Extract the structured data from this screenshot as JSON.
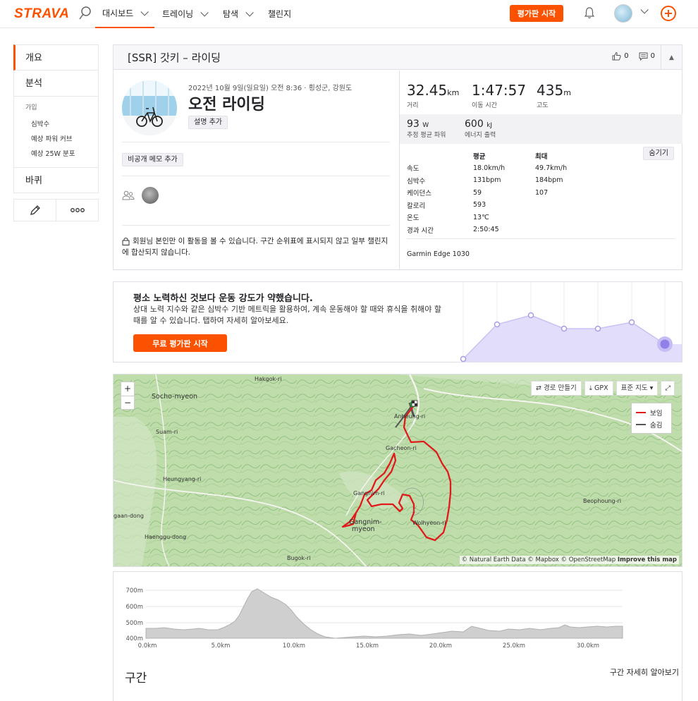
{
  "nav": {
    "logo": "STRAVA",
    "items": [
      {
        "label": "대시보드"
      },
      {
        "label": "트레이닝"
      },
      {
        "label": "탐색"
      },
      {
        "label": "챌린지"
      }
    ],
    "cta": "평가판 시작",
    "brand_color": "#fc5200"
  },
  "sidebar": {
    "overview": "개요",
    "analysis": "분석",
    "group_title": "가입",
    "sub_items": [
      "심박수",
      "예상 파워 커브",
      "예상 25W 분포"
    ],
    "bike": "바퀴"
  },
  "activity": {
    "header": "[SSR] 갓키 – 라이딩",
    "kudos": "0",
    "comments": "0",
    "meta": "2022년 10월 9일(일요일) 오전 8:36 · 횡성군, 강원도",
    "title": "오전 라이딩",
    "add_description": "설명 추가",
    "private_note": "비공개 메모 추가",
    "privacy": "회원님 본인만 이 활동을 볼 수 있습니다. 구간 순위표에 표시되지 않고 일부 챌린지에 합산되지 않습니다.",
    "stats": {
      "distance_value": "32.45",
      "distance_unit": "km",
      "distance_label": "거리",
      "time_value": "1:47:57",
      "time_label": "이동 시간",
      "elev_value": "435",
      "elev_unit": "m",
      "elev_label": "고도",
      "power_value": "93",
      "power_unit": "W",
      "power_label": "추정 평균 파워",
      "energy_value": "600",
      "energy_unit": "kJ",
      "energy_label": "에너지 출력"
    },
    "table_head": {
      "avg": "평균",
      "max": "최대"
    },
    "hide": "숨기기",
    "rows": [
      {
        "label": "속도",
        "avg": "18.0km/h",
        "max": "49.7km/h"
      },
      {
        "label": "심박수",
        "avg": "131bpm",
        "max": "184bpm"
      },
      {
        "label": "케이던스",
        "avg": "59",
        "max": "107"
      },
      {
        "label": "칼로리",
        "avg": "593",
        "max": ""
      },
      {
        "label": "온도",
        "avg": "13℃",
        "max": ""
      },
      {
        "label": "경과 시간",
        "avg": "2:50:45",
        "max": ""
      }
    ],
    "device": "Garmin Edge 1030"
  },
  "promo": {
    "title": "평소 노력하신 것보다 운동 강도가 약했습니다.",
    "body": "상대 노력 지수와 같은 심박수 기반 메트릭을 활용하여, 계속 운동해야 할 때와 휴식을 취해야 할 때를 알 수 있습니다. 탭하여 자세히 알아보세요.",
    "button": "무료 평가판 시작",
    "chart_color": "#d9d4f7"
  },
  "map": {
    "tools": {
      "route": "경로 만들기",
      "gpx": "GPX",
      "style": "표준 지도"
    },
    "legend": {
      "shown": "보임",
      "hidden": "숨김"
    },
    "route_color": "#e01b1b",
    "hidden_color": "#555555",
    "attribution_prefix": "© Natural Earth Data © Mapbox © OpenStreetMap",
    "attribution_link": "Improve this map",
    "labels": {
      "hakgok": "Hakgok-ri",
      "socho": "Socho-myeon",
      "suam": "Suam-ri",
      "heungyang": "Heungyang-ri",
      "gaan": "gaan-dong",
      "haenggu": "Haenggu-dong",
      "bugok": "Bugok-ri",
      "anheung": "Anheung-ri",
      "gacheon": "Gacheon-ri",
      "gangnim_ri": "Gangnim-ri",
      "gangnim_myeon_1": "Gangnim-",
      "gangnim_myeon_2": "myeon",
      "wolhyeon": "Wolhyeon-ri",
      "beophoung": "Beophoung-ri"
    }
  },
  "elevation": {
    "y_ticks": [
      "700m",
      "600m",
      "500m",
      "400m"
    ],
    "x_ticks": [
      "0.0km",
      "5.0km",
      "10.0km",
      "15.0km",
      "20.0km",
      "25.0km",
      "30.0km"
    ],
    "fill_color": "#cfcfcf"
  },
  "segments": {
    "title": "구간",
    "link": "구간 자세히 알아보기"
  }
}
